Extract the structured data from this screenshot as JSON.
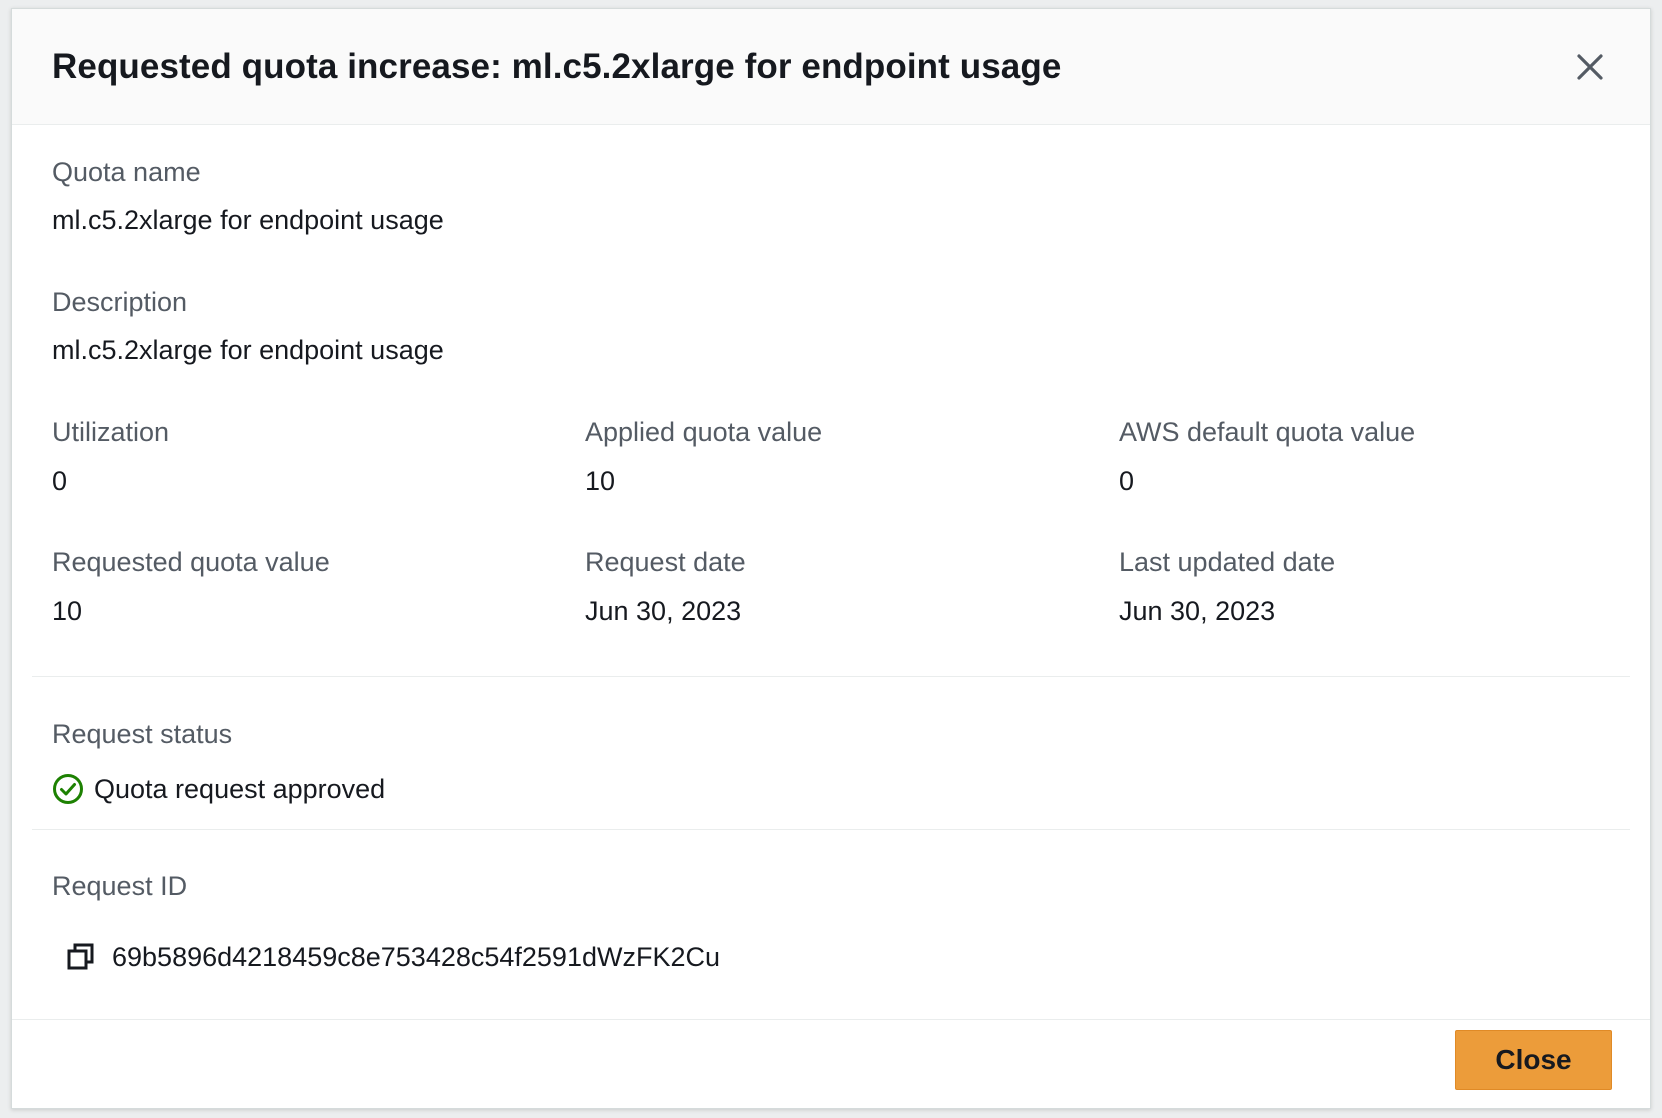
{
  "modal": {
    "title": "Requested quota increase: ml.c5.2xlarge for endpoint usage",
    "close_icon": "close-x-icon"
  },
  "details": {
    "quota_name": {
      "label": "Quota name",
      "value": "ml.c5.2xlarge for endpoint usage"
    },
    "description": {
      "label": "Description",
      "value": "ml.c5.2xlarge for endpoint usage"
    },
    "utilization": {
      "label": "Utilization",
      "value": "0"
    },
    "applied_quota_value": {
      "label": "Applied quota value",
      "value": "10"
    },
    "aws_default_quota_value": {
      "label": "AWS default quota value",
      "value": "0"
    },
    "requested_quota_value": {
      "label": "Requested quota value",
      "value": "10"
    },
    "request_date": {
      "label": "Request date",
      "value": "Jun 30, 2023"
    },
    "last_updated_date": {
      "label": "Last updated date",
      "value": "Jun 30, 2023"
    }
  },
  "status": {
    "label": "Request status",
    "value": "Quota request approved",
    "icon": "check-circle-icon",
    "color": "#1d8102"
  },
  "request_id": {
    "label": "Request ID",
    "value": "69b5896d4218459c8e753428c54f2591dWzFK2Cu",
    "icon": "copy-icon"
  },
  "footer": {
    "close_label": "Close",
    "accent_color": "#ec9c3a"
  }
}
